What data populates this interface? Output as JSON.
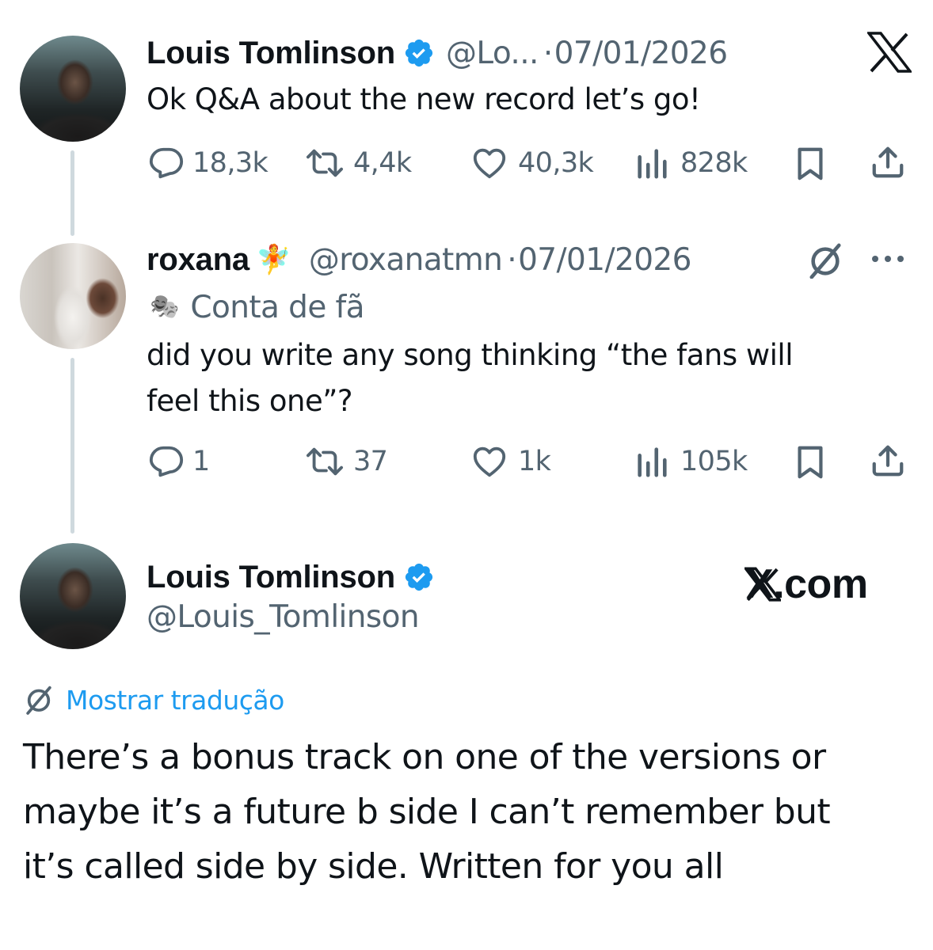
{
  "tweet1": {
    "author_name": "Louis Tomlinson",
    "handle": "@Lo...",
    "separator": "·",
    "date": "07/01/2026",
    "text": "Ok Q&A about the new record let’s go!",
    "stats": {
      "replies": "18,3k",
      "reposts": "4,4k",
      "likes": "40,3k",
      "views": "828k"
    }
  },
  "tweet2": {
    "author_name": "roxana",
    "handle": "@roxanatmn",
    "separator": "·",
    "date": "07/01/2026",
    "label": "Conta de fã",
    "text_line1": "did you write any song thinking “the fans will",
    "text_line2": "feel this one”?",
    "stats": {
      "replies": "1",
      "reposts": "37",
      "likes": "1k",
      "views": "105k"
    }
  },
  "tweet3": {
    "author_name": "Louis Tomlinson",
    "handle": "@Louis_Tomlinson",
    "watermark": "X.com",
    "translate_label": "Mostrar tradução",
    "text_line1": "There’s a bonus track on one of the versions or",
    "text_line2": "maybe it’s a future b side I can’t remember but",
    "text_line3": "it’s called side by side. Written for you all"
  },
  "icons": {
    "verified_color": "#1d9bf0",
    "link_color": "#1d9bf0",
    "muted_color": "#536471",
    "fairy": "🧚",
    "theater": "🎭"
  }
}
